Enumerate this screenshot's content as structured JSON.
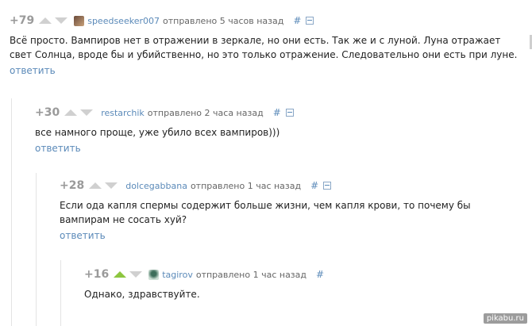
{
  "comments": [
    {
      "rating": "+79",
      "user": "speedseeker007",
      "meta": "отправлено 5 часов назад",
      "hash": "#",
      "text": "Всё просто. Вампиров нет в отражении в зеркале, но они есть. Так же и с луной. Луна отражает свет Солнца, вроде бы и убийственно, но это только отражение. Следовательно они есть при луне.",
      "reply": "ответить"
    },
    {
      "rating": "+30",
      "user": "restarchik",
      "meta": "отправлено 2 часа назад",
      "hash": "#",
      "text": "все намного проще, уже убило всех вампиров)))",
      "reply": "ответить"
    },
    {
      "rating": "+28",
      "user": "dolcegabbana",
      "meta": "отправлено 1 час назад",
      "hash": "#",
      "text": "Если ода капля спермы содержит больше жизни, чем капля крови, то почему бы вампирам не сосать хуй?",
      "reply": "ответить"
    },
    {
      "rating": "+16",
      "user": "tagirov",
      "meta": "отправлено 1 час назад",
      "hash": "#",
      "text": "Однако, здравствуйте."
    }
  ],
  "watermark": "pikabu.ru",
  "colors": {
    "link": "#5b8ab9",
    "upvote_active": "#8dc63f"
  }
}
